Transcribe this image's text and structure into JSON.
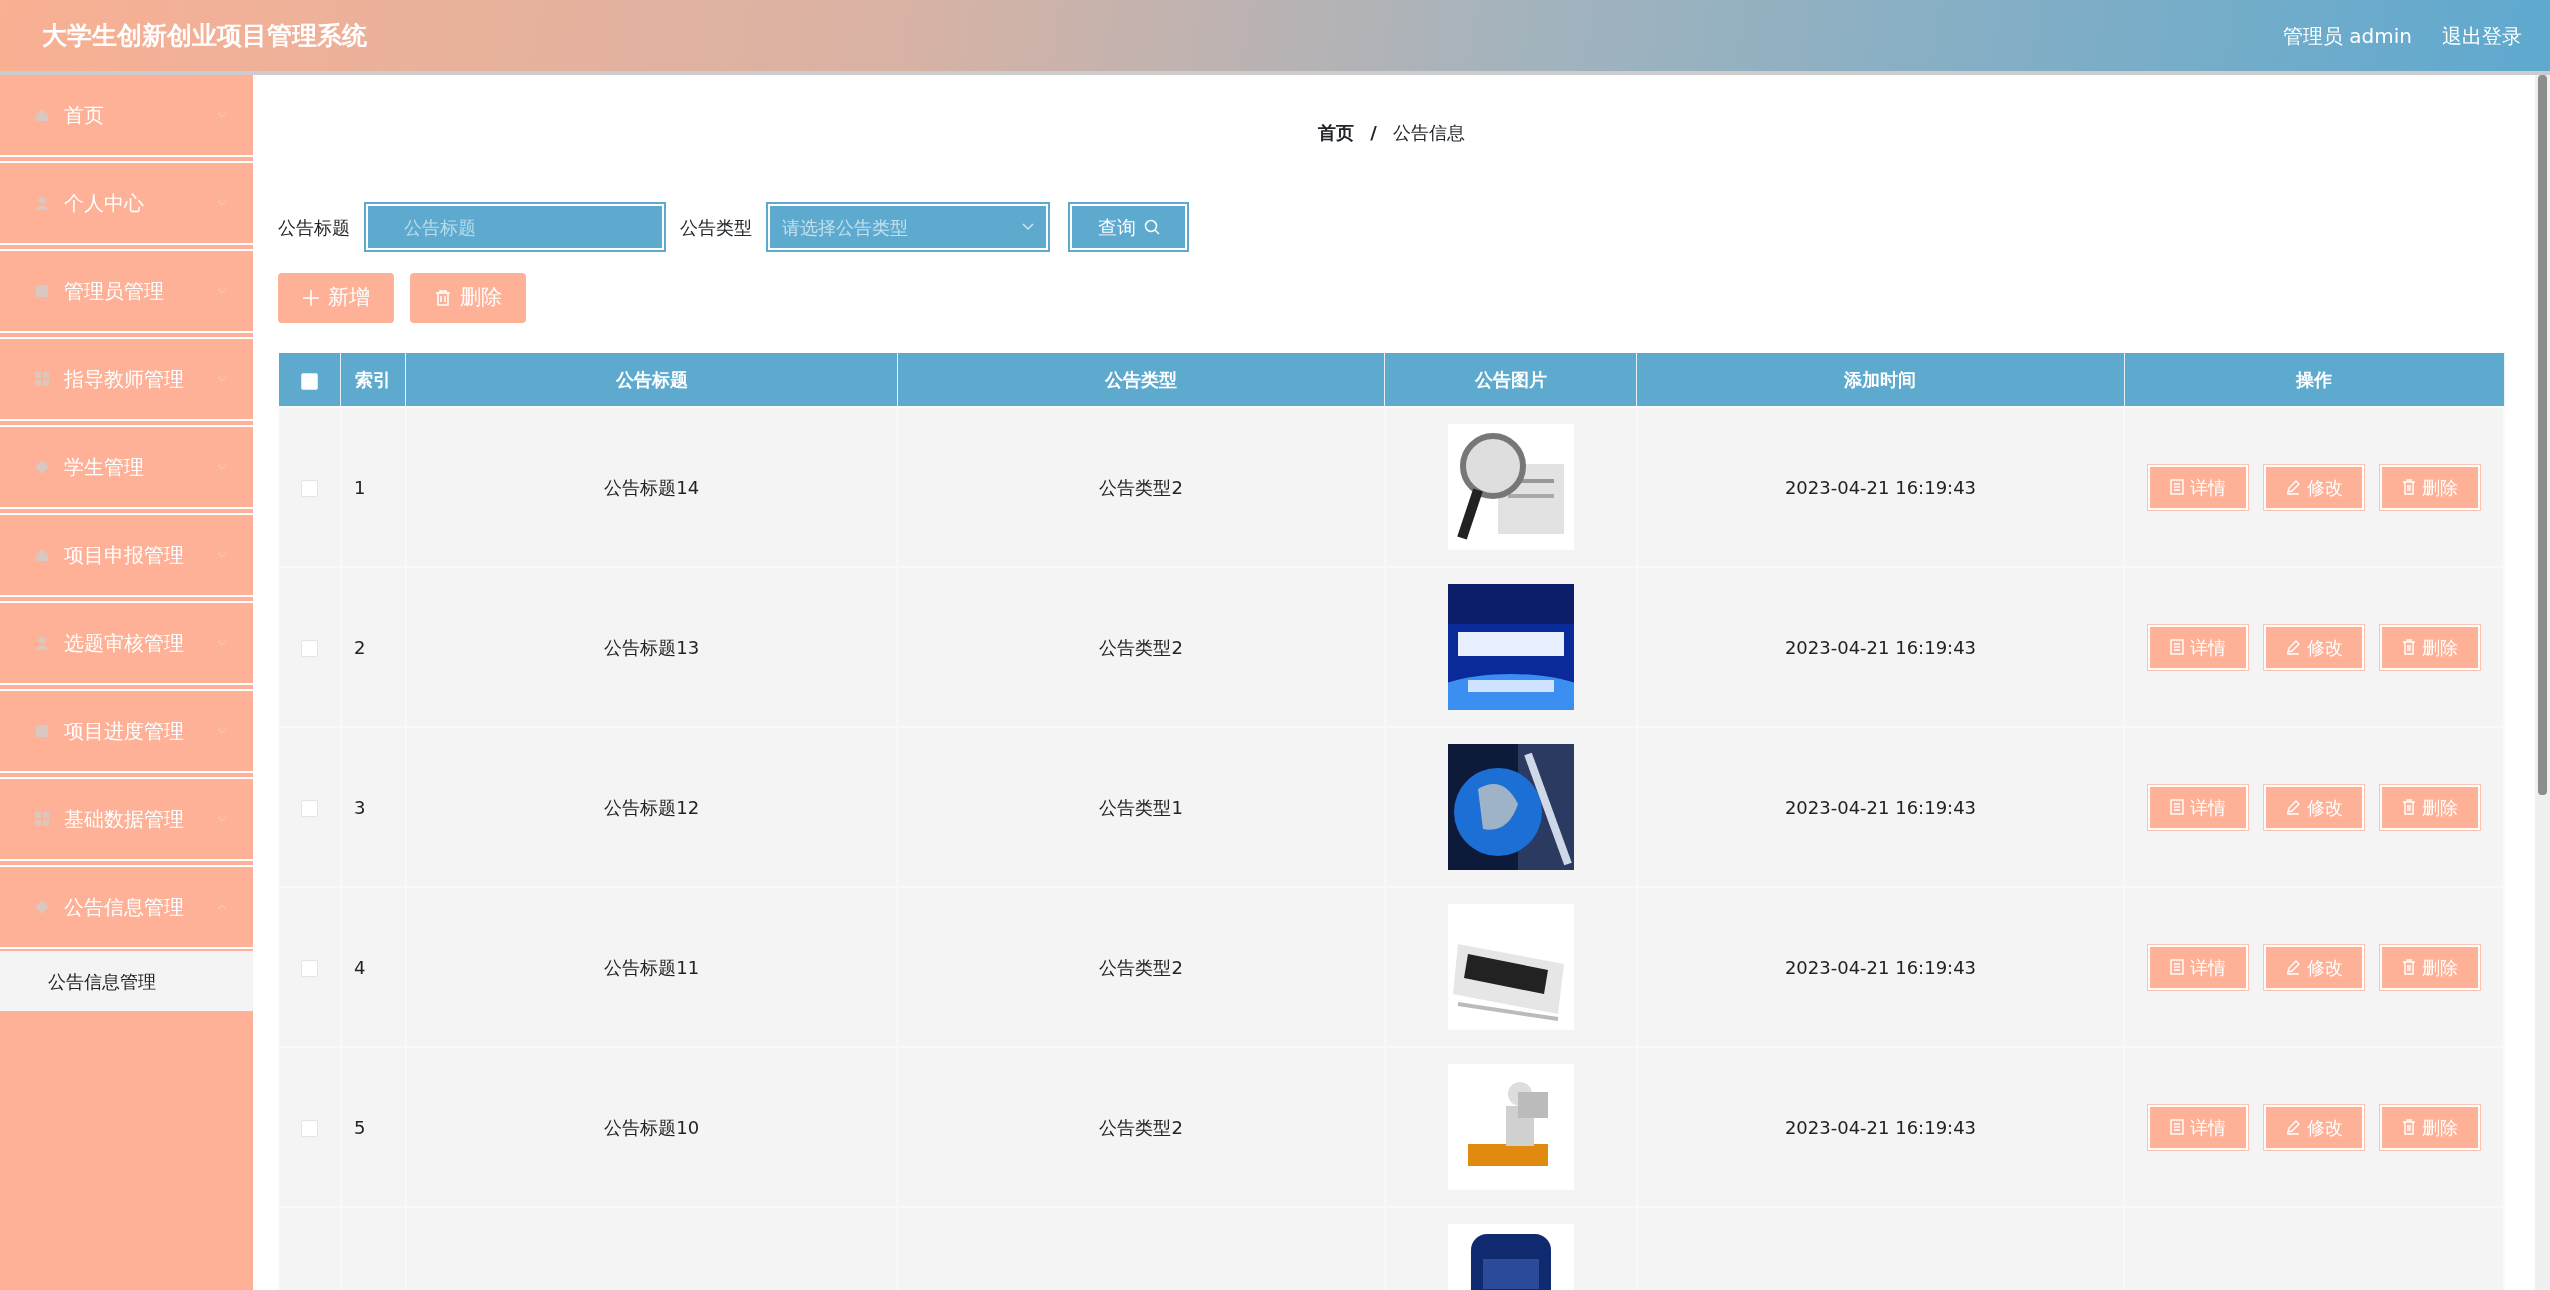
{
  "header": {
    "title": "大学生创新创业项目管理系统",
    "user": "管理员 admin",
    "logout": "退出登录"
  },
  "sidebar": {
    "items": [
      {
        "label": "首页",
        "expanded": false
      },
      {
        "label": "个人中心",
        "expanded": false
      },
      {
        "label": "管理员管理",
        "expanded": false
      },
      {
        "label": "指导教师管理",
        "expanded": false
      },
      {
        "label": "学生管理",
        "expanded": false
      },
      {
        "label": "项目申报管理",
        "expanded": false
      },
      {
        "label": "选题审核管理",
        "expanded": false
      },
      {
        "label": "项目进度管理",
        "expanded": false
      },
      {
        "label": "基础数据管理",
        "expanded": false
      },
      {
        "label": "公告信息管理",
        "expanded": true,
        "children": [
          {
            "label": "公告信息管理",
            "selected": true
          }
        ]
      }
    ]
  },
  "breadcrumb": {
    "items": [
      "首页",
      "公告信息"
    ],
    "separator": "/"
  },
  "search": {
    "fields": [
      {
        "label": "公告标题",
        "kind": "input",
        "placeholder": "公告标题"
      },
      {
        "label": "公告类型",
        "kind": "select",
        "placeholder": "请选择公告类型"
      }
    ],
    "button": "查询"
  },
  "actions": [
    "新增",
    "删除"
  ],
  "table": {
    "select_all": {
      "checked": false
    },
    "columns": [
      "索引",
      "公告标题",
      "公告类型",
      "公告图片",
      "添加时间",
      "操作"
    ],
    "rows": [
      {
        "checked": false,
        "index": "1",
        "title": "公告标题14",
        "type": "公告类型2",
        "image": {
          "kind": "picture"
        },
        "time": "2023-04-21 16:19:43",
        "buttons": [
          "详情",
          "修改",
          "删除"
        ]
      },
      {
        "checked": false,
        "index": "2",
        "title": "公告标题13",
        "type": "公告类型2",
        "image": {
          "kind": "picture"
        },
        "time": "2023-04-21 16:19:43",
        "buttons": [
          "详情",
          "修改",
          "删除"
        ]
      },
      {
        "checked": false,
        "index": "3",
        "title": "公告标题12",
        "type": "公告类型1",
        "image": {
          "kind": "picture"
        },
        "time": "2023-04-21 16:19:43",
        "buttons": [
          "详情",
          "修改",
          "删除"
        ]
      },
      {
        "checked": false,
        "index": "4",
        "title": "公告标题11",
        "type": "公告类型2",
        "image": {
          "kind": "picture"
        },
        "time": "2023-04-21 16:19:43",
        "buttons": [
          "详情",
          "修改",
          "删除"
        ]
      },
      {
        "checked": false,
        "index": "5",
        "title": "公告标题10",
        "type": "公告类型2",
        "image": {
          "kind": "picture"
        },
        "time": "2023-04-21 16:19:43",
        "buttons": [
          "详情",
          "修改",
          "删除"
        ]
      },
      {
        "image": {
          "kind": "picture"
        }
      }
    ]
  }
}
